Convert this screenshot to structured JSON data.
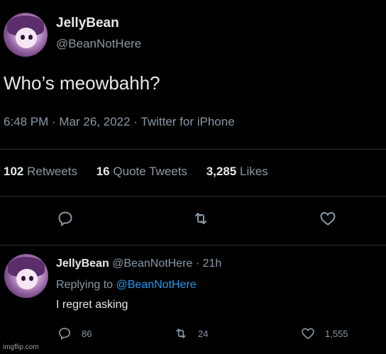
{
  "tweet": {
    "author_name": "JellyBean",
    "author_handle": "@BeanNotHere",
    "text": "Who’s meowbahh?",
    "meta": "6:48 PM · Mar 26, 2022 · Twitter for iPhone",
    "stats": {
      "retweets_count": "102",
      "retweets_label": "Retweets",
      "quotes_count": "16",
      "quotes_label": "Quote Tweets",
      "likes_count": "3,285",
      "likes_label": "Likes"
    },
    "actions": [
      "reply-icon",
      "retweet-icon",
      "like-icon"
    ]
  },
  "reply": {
    "author_name": "JellyBean",
    "author_handle": "@BeanNotHere",
    "time": "· 21h",
    "replying_to_prefix": "Replying to",
    "replying_to_handle": "@BeanNotHere",
    "text": "I regret asking",
    "reply_count": "86",
    "retweet_count": "24",
    "like_count": "1,555"
  },
  "watermark": "imgflip.com",
  "colors": {
    "background": "#000000",
    "text": "#e7e9ea",
    "secondary": "#8b98a5",
    "link": "#1d9bf0",
    "divider": "#2f3336"
  }
}
